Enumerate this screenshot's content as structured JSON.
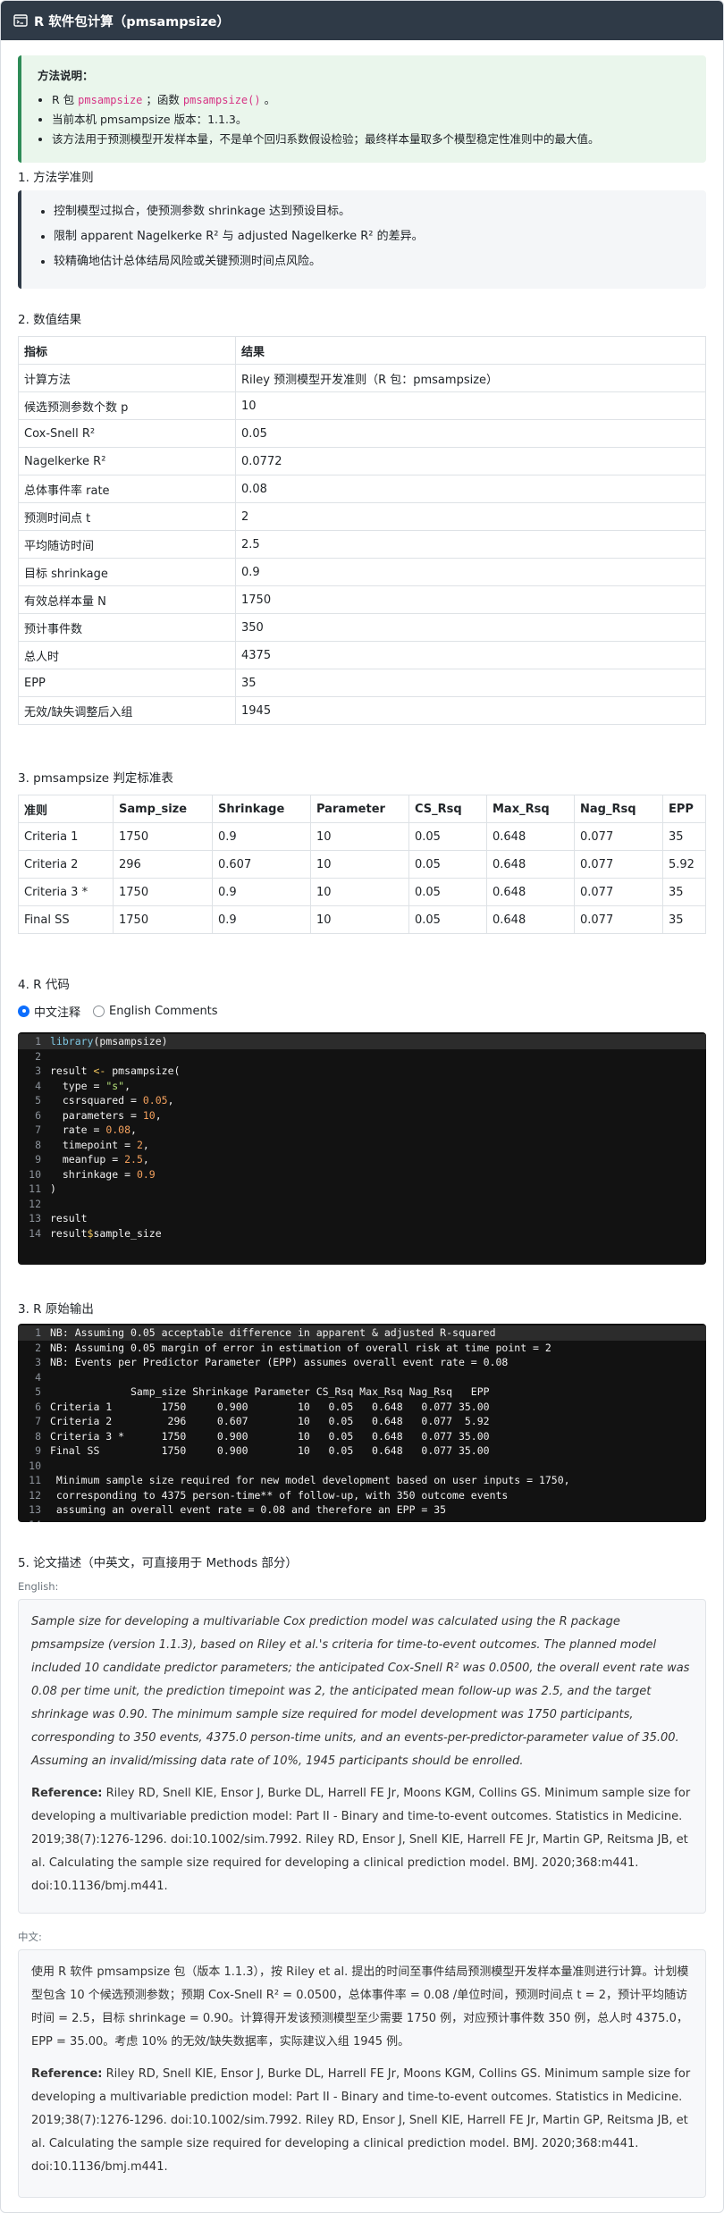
{
  "header": {
    "title": "R 软件包计算（pmsampsize）"
  },
  "note": {
    "title": "方法说明：",
    "item1_prefix": "R 包",
    "item1_pkg": "pmsampsize",
    "item1_mid": "；函数",
    "item1_fn": "pmsampsize()",
    "item1_end": "。",
    "item2": "当前本机 pmsampsize 版本：1.1.3。",
    "item3": "该方法用于预测模型开发样本量，不是单个回归系数假设检验；最终样本量取多个模型稳定性准则中的最大值。"
  },
  "section1": {
    "title": "1. 方法学准则",
    "items": [
      "控制模型过拟合，使预测参数 shrinkage 达到预设目标。",
      "限制 apparent Nagelkerke R² 与 adjusted Nagelkerke R² 的差异。",
      "较精确地估计总体结局风险或关键预测时间点风险。"
    ]
  },
  "section2": {
    "title": "2. 数值结果",
    "headers": [
      "指标",
      "结果"
    ],
    "rows": [
      [
        "计算方法",
        "Riley 预测模型开发准则（R 包：pmsampsize）"
      ],
      [
        "候选预测参数个数 p",
        "10"
      ],
      [
        "Cox-Snell R²",
        "0.05"
      ],
      [
        "Nagelkerke R²",
        "0.0772"
      ],
      [
        "总体事件率 rate",
        "0.08"
      ],
      [
        "预测时间点 t",
        "2"
      ],
      [
        "平均随访时间",
        "2.5"
      ],
      [
        "目标 shrinkage",
        "0.9"
      ],
      [
        "有效总样本量 N",
        "1750"
      ],
      [
        "预计事件数",
        "350"
      ],
      [
        "总人时",
        "4375"
      ],
      [
        "EPP",
        "35"
      ],
      [
        "无效/缺失调整后入组",
        "1945"
      ]
    ]
  },
  "section3": {
    "title": "3. pmsampsize 判定标准表",
    "headers": [
      "准则",
      "Samp_size",
      "Shrinkage",
      "Parameter",
      "CS_Rsq",
      "Max_Rsq",
      "Nag_Rsq",
      "EPP"
    ],
    "rows": [
      [
        "Criteria 1",
        "1750",
        "0.9",
        "10",
        "0.05",
        "0.648",
        "0.077",
        "35"
      ],
      [
        "Criteria 2",
        "296",
        "0.607",
        "10",
        "0.05",
        "0.648",
        "0.077",
        "5.92"
      ],
      [
        "Criteria 3 *",
        "1750",
        "0.9",
        "10",
        "0.05",
        "0.648",
        "0.077",
        "35"
      ],
      [
        "Final SS",
        "1750",
        "0.9",
        "10",
        "0.05",
        "0.648",
        "0.077",
        "35"
      ]
    ]
  },
  "section4": {
    "title": "4. R 代码",
    "radio_zh": "中文注释",
    "radio_en": "English Comments",
    "code": {
      "l1_fn": "library",
      "l1_rest": "(pmsampsize)",
      "l3_a": "result ",
      "l3_op": "<-",
      "l3_b": " pmsampsize(",
      "l4_a": "  type = ",
      "l4_s": "\"s\"",
      "l4_c": ",",
      "l5_a": "  csrsquared = ",
      "l5_n": "0.05",
      "l6_a": "  parameters = ",
      "l6_n": "10",
      "l7_a": "  rate = ",
      "l7_n": "0.08",
      "l8_a": "  timepoint = ",
      "l8_n": "2",
      "l9_a": "  meanfup = ",
      "l9_n": "2.5",
      "l10_a": "  shrinkage = ",
      "l10_n": "0.9",
      "l11": ")",
      "l13": "result",
      "l14_a": "result",
      "l14_op": "$",
      "l14_b": "sample_size",
      "comma": ","
    }
  },
  "section_out": {
    "title": "3. R 原始输出",
    "lines": [
      "NB: Assuming 0.05 acceptable difference in apparent & adjusted R-squared",
      "NB: Assuming 0.05 margin of error in estimation of overall risk at time point = 2",
      "NB: Events per Predictor Parameter (EPP) assumes overall event rate = 0.08",
      "",
      "             Samp_size Shrinkage Parameter CS_Rsq Max_Rsq Nag_Rsq   EPP",
      "Criteria 1        1750     0.900        10   0.05   0.648   0.077 35.00",
      "Criteria 2         296     0.607        10   0.05   0.648   0.077  5.92",
      "Criteria 3 *      1750     0.900        10   0.05   0.648   0.077 35.00",
      "Final SS          1750     0.900        10   0.05   0.648   0.077 35.00",
      "",
      " Minimum sample size required for new model development based on user inputs = 1750,",
      " corresponding to 4375 person-time** of follow-up, with 350 outcome events",
      " assuming an overall event rate = 0.08 and therefore an EPP = 35",
      ""
    ]
  },
  "section5": {
    "title": "5. 论文描述（中英文，可直接用于 Methods 部分）",
    "en_label": "English:",
    "en_text": "Sample size for developing a multivariable Cox prediction model was calculated using the R package pmsampsize (version 1.1.3), based on Riley et al.'s criteria for time-to-event outcomes. The planned model included 10 candidate predictor parameters; the anticipated Cox-Snell R² was 0.0500, the overall event rate was 0.08 per time unit, the prediction timepoint was 2, the anticipated mean follow-up was 2.5, and the target shrinkage was 0.90. The minimum sample size required for model development was 1750 participants, corresponding to 350 events, 4375.0 person-time units, and an events-per-predictor-parameter value of 35.00. Assuming an invalid/missing data rate of 10%, 1945 participants should be enrolled.",
    "ref_label": "Reference:",
    "ref_text": " Riley RD, Snell KIE, Ensor J, Burke DL, Harrell FE Jr, Moons KGM, Collins GS. Minimum sample size for developing a multivariable prediction model: Part II - Binary and time-to-event outcomes. Statistics in Medicine. 2019;38(7):1276-1296. doi:10.1002/sim.7992. Riley RD, Ensor J, Snell KIE, Harrell FE Jr, Martin GP, Reitsma JB, et al. Calculating the sample size required for developing a clinical prediction model. BMJ. 2020;368:m441. doi:10.1136/bmj.m441.",
    "zh_label": "中文:",
    "zh_text": "使用 R 软件 pmsampsize 包（版本 1.1.3），按 Riley et al. 提出的时间至事件结局预测模型开发样本量准则进行计算。计划模型包含 10 个候选预测参数；预期 Cox-Snell R² = 0.0500，总体事件率 = 0.08 /单位时间，预测时间点 t = 2，预计平均随访时间 = 2.5，目标 shrinkage = 0.90。计算得开发该预测模型至少需要 1750 例，对应预计事件数 350 例，总人时 4375.0，EPP = 35.00。考虑 10% 的无效/缺失数据率，实际建议入组 1945 例。"
  },
  "colors": {
    "header_bg": "#2f3a47",
    "note_bg": "#eaf6ec",
    "note_border": "#2e8b57",
    "code_bg": "#121212",
    "accent": "#d63384"
  },
  "icons": {
    "header": "terminal-window-icon"
  }
}
